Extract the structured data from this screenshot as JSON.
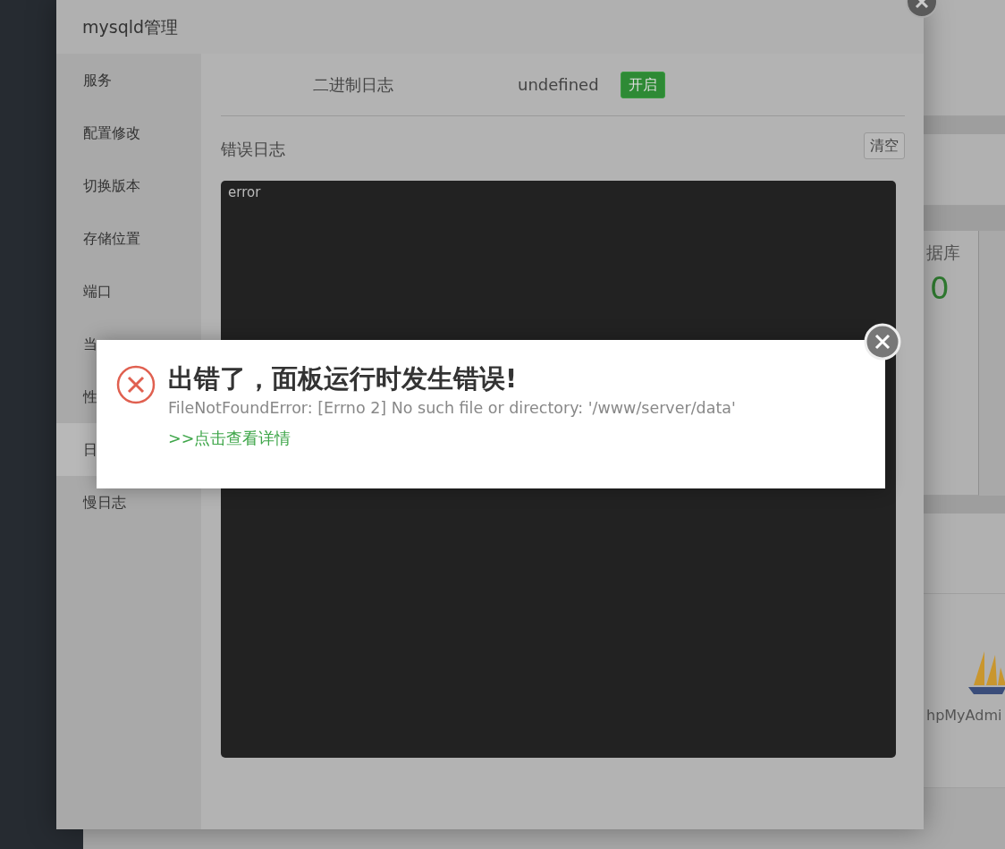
{
  "window": {
    "title": "mysqld管理"
  },
  "sidebar": {
    "items": [
      {
        "label": "服务",
        "selected": false
      },
      {
        "label": "配置修改",
        "selected": false
      },
      {
        "label": "切换版本",
        "selected": false
      },
      {
        "label": "存储位置",
        "selected": false
      },
      {
        "label": "端口",
        "selected": false
      },
      {
        "label": "当",
        "selected": false
      },
      {
        "label": "性",
        "selected": false
      },
      {
        "label": "日",
        "selected": true
      },
      {
        "label": "慢日志",
        "selected": false
      }
    ]
  },
  "binlog": {
    "label": "二进制日志",
    "value": "undefined",
    "button": "开启"
  },
  "error_log": {
    "label": "错误日志",
    "clear_button": "清空",
    "content": "error"
  },
  "error_popup": {
    "title": "出错了，面板运行时发生错误!",
    "message": "FileNotFoundError: [Errno 2] No such file or directory: '/www/server/data'",
    "link": ">>点击查看详情"
  },
  "background": {
    "stat_label": "据库",
    "stat_value": "0",
    "app_label": "hpMyAdmi"
  }
}
